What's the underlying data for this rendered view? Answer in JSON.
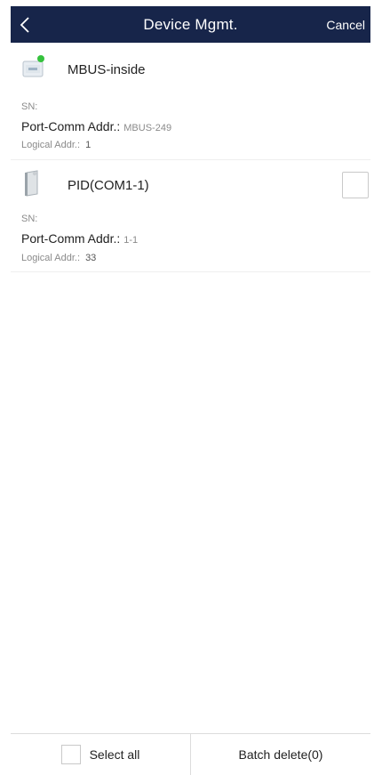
{
  "header": {
    "title": "Device Mgmt.",
    "cancel_label": "Cancel",
    "background_color": "#17254a"
  },
  "devices": [
    {
      "name": "MBUS-inside",
      "icon": "mbus-device-icon",
      "sn_label": "SN:",
      "port_label": "Port-Comm Addr.:",
      "port_value": "MBUS-249",
      "logical_label": "Logical Addr.:",
      "logical_value": "1",
      "selectable": false
    },
    {
      "name": "PID(COM1-1)",
      "icon": "pid-device-icon",
      "sn_label": "SN:",
      "port_label": "Port-Comm Addr.:",
      "port_value": "1-1",
      "logical_label": "Logical Addr.:",
      "logical_value": "33",
      "selectable": true
    }
  ],
  "footer": {
    "select_all_label": "Select all",
    "batch_delete_label": "Batch delete(0)"
  }
}
